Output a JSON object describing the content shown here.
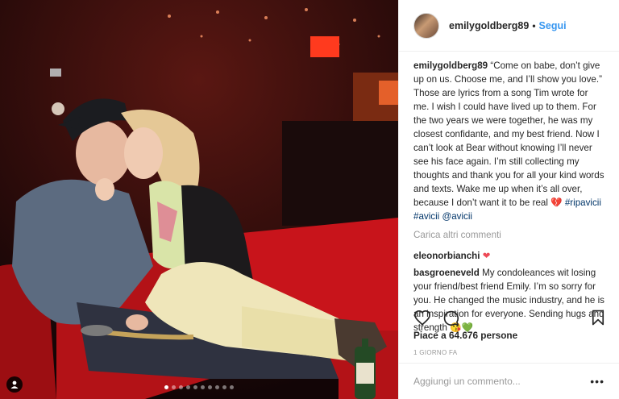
{
  "header": {
    "username": "emilygoldberg89",
    "separator": "•",
    "follow_label": "Segui"
  },
  "caption": {
    "username": "emilygoldberg89",
    "text": "“Come on babe, don’t give up on us. Choose me, and I’ll show you love.” Those are lyrics from a song Tim wrote for me. I wish I could have lived up to them. For the two years we were together, he was my closest confidante, and my best friend. Now I can’t look at Bear without knowing I’ll never see his face again. I’m still collecting my thoughts and thank you for all your kind words and texts. Wake me up when it’s all over, because I don’t want it to be real",
    "emoji": "💔",
    "tags": [
      "#ripavicii",
      "#avicii",
      "@avicii"
    ]
  },
  "load_more_label": "Carica altri commenti",
  "comments": [
    {
      "username": "eleonorbianchi",
      "text": "",
      "emoji": "❤"
    },
    {
      "username": "basgroeneveld",
      "text": "My condoleances wit losing your friend/best friend Emily. I’m so sorry for you. He changed the music industry, and he is an inspiration for everyone. Sending hugs and strength",
      "emoji": "😘💚"
    }
  ],
  "actions": {
    "like_icon": "heart-outline-icon",
    "comment_icon": "comment-bubble-icon",
    "save_icon": "bookmark-icon"
  },
  "likes_label": "Piace a 64.676 persone",
  "timestamp": "1 GIORNO FA",
  "add_comment": {
    "placeholder": "Aggiungi un commento..."
  },
  "more_options": "•••",
  "photo": {
    "description_icon": "person-tag-icon",
    "carousel_total": 10,
    "carousel_active": 0
  },
  "colors": {
    "link_blue": "#3897f0",
    "tag_blue": "#003569",
    "muted": "#999999",
    "border": "#efefef",
    "heart_red": "#ed4956"
  }
}
